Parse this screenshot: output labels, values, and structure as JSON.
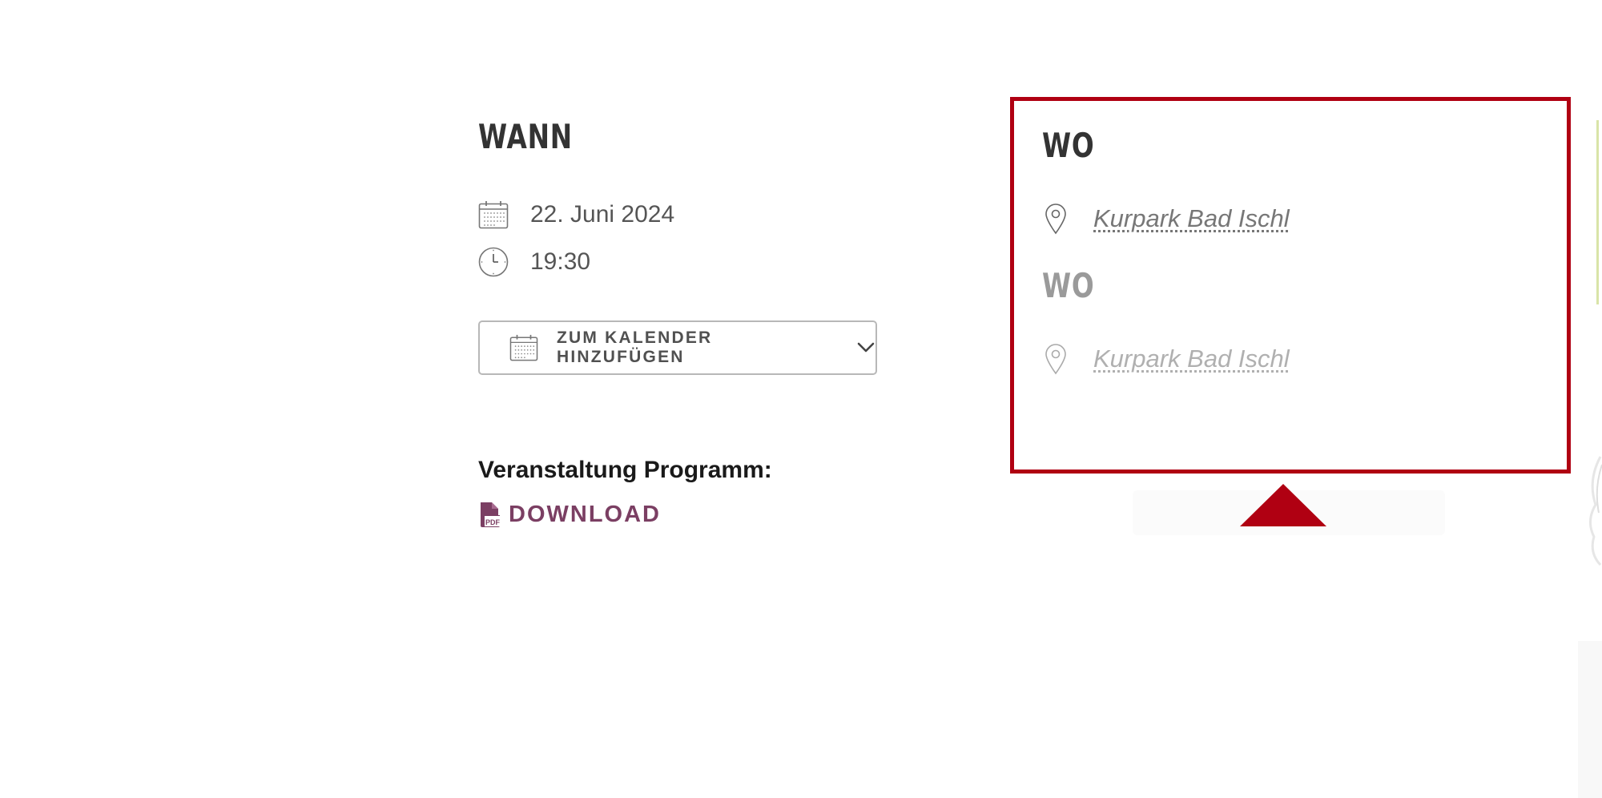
{
  "when": {
    "heading": "WANN",
    "date": "22. Juni 2024",
    "time": "19:30",
    "add_to_calendar_label": "ZUM KALENDER HINZUFÜGEN"
  },
  "program": {
    "title": "Veranstaltung Programm:",
    "download_label": "DOWNLOAD",
    "download_icon": "pdf-file-icon"
  },
  "where": [
    {
      "heading": "WO",
      "location": "Kurpark Bad Ischl"
    },
    {
      "heading": "WO",
      "location": "Kurpark Bad Ischl"
    }
  ],
  "colors": {
    "highlight_border": "#b00012",
    "download_link": "#7b3f63",
    "heading": "#333333",
    "text": "#555555"
  },
  "icons": {
    "date": "calendar-icon",
    "time": "clock-icon",
    "location": "map-pin-icon",
    "dropdown": "chevron-down-icon"
  }
}
